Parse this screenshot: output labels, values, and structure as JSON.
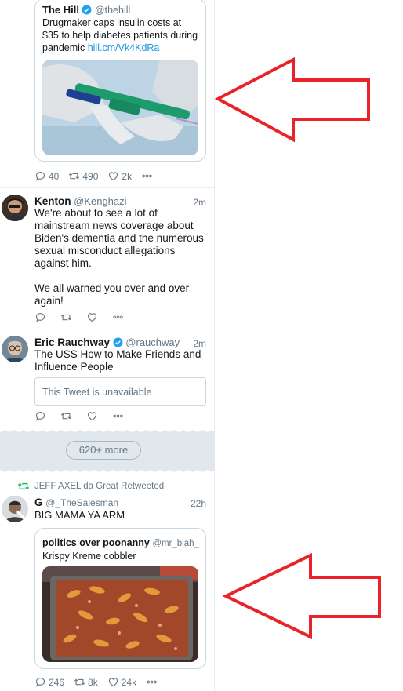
{
  "tweet1": {
    "quote": {
      "name": "The Hill",
      "handle": "@thehill",
      "text": "Drugmaker caps insulin costs at $35 to help diabetes patients during pandemic",
      "link": "hill.cm/Vk4KdRa"
    },
    "actions": {
      "replies": "40",
      "retweets": "490",
      "likes": "2k"
    }
  },
  "tweet2": {
    "name": "Kenton",
    "handle": "@Kenghazi",
    "time": "2m",
    "text_p1": "We're about to see a lot of mainstream news coverage about Biden's dementia and the numerous sexual misconduct allegations against him.",
    "text_p2": "We all warned you over and over again!"
  },
  "tweet3": {
    "name": "Eric Rauchway",
    "handle": "@rauchway",
    "time": "2m",
    "text": "The USS How to Make Friends and Influence People",
    "unavailable": "This Tweet is unavailable"
  },
  "more": {
    "label": "620+ more"
  },
  "tweet4": {
    "retweeted_by": "JEFF AXEL da Great Retweeted",
    "name": "G",
    "handle": "@_TheSalesman",
    "time": "22h",
    "text": "BIG MAMA YA ARM",
    "quote": {
      "name": "politics over poonanny",
      "handle": "@mr_blah_...",
      "text": "Krispy Kreme cobbler"
    },
    "actions": {
      "replies": "246",
      "retweets": "8k",
      "likes": "24k"
    }
  },
  "colors": {
    "annotation_arrow": "#e8242a",
    "brand": "#1da1f2",
    "retweet_green": "#17bf63"
  }
}
